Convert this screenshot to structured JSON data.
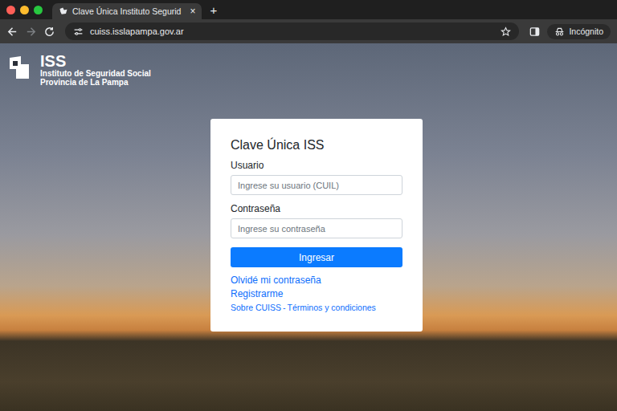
{
  "browser": {
    "tab_title": "Clave Única Instituto Segurid",
    "tab_close": "×",
    "new_tab": "+",
    "url": "cuiss.isslapampa.gov.ar",
    "incognito_label": "Incógnito"
  },
  "logo": {
    "mark": "ISS",
    "line1": "Instituto de Seguridad Social",
    "line2": "Provincia de La Pampa"
  },
  "login": {
    "title": "Clave Única ISS",
    "fields": [
      {
        "label": "Usuario",
        "placeholder": "Ingrese su usuario (CUIL)"
      },
      {
        "label": "Contraseña",
        "placeholder": "Ingrese su contraseña"
      }
    ],
    "submit": "Ingresar",
    "links": [
      "Olvidé mi contraseña",
      "Registrarme"
    ],
    "footer_links": [
      "Sobre CUISS",
      "Términos y condiciones"
    ],
    "separator": "-"
  }
}
